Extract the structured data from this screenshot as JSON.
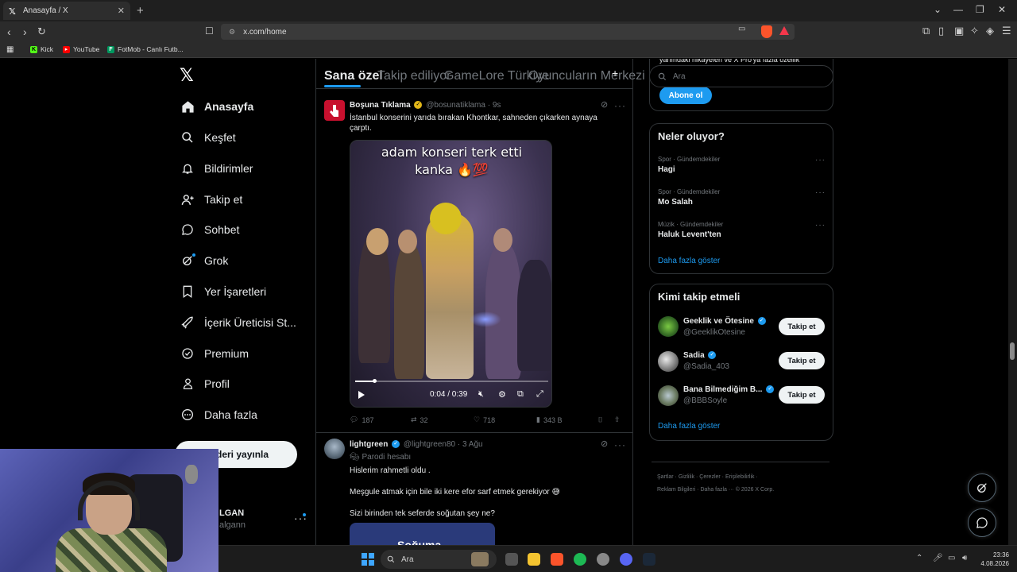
{
  "browser": {
    "tab_title": "Anasayfa / X",
    "url": "x.com/home",
    "bookmarks": [
      "Kick",
      "YouTube",
      "FotMob - Canlı Futb..."
    ]
  },
  "sidebar": {
    "items": [
      {
        "label": "Anasayfa",
        "icon": "home-icon"
      },
      {
        "label": "Keşfet",
        "icon": "search-icon"
      },
      {
        "label": "Bildirimler",
        "icon": "bell-icon"
      },
      {
        "label": "Takip et",
        "icon": "add-user-icon"
      },
      {
        "label": "Sohbet",
        "icon": "chat-icon"
      },
      {
        "label": "Grok",
        "icon": "grok-icon"
      },
      {
        "label": "Yer İşaretleri",
        "icon": "bookmark-icon"
      },
      {
        "label": "İçerik Üreticisi St...",
        "icon": "rocket-icon"
      },
      {
        "label": "Premium",
        "icon": "premium-icon"
      },
      {
        "label": "Profil",
        "icon": "person-icon"
      },
      {
        "label": "Daha fazla",
        "icon": "more-circle-icon"
      }
    ],
    "post_button": "deri yayınla",
    "user_name": "LGAN",
    "user_handle": "algann"
  },
  "feed": {
    "tabs": [
      "Sana özel",
      "Takip ediliyor",
      "GameLore Türkiye",
      "Oyuncuların Merkezi"
    ],
    "tweet1": {
      "name": "Boşuna Tıklama",
      "handle": "@bosunatiklama",
      "time": "9s",
      "text": "İstanbul konserini yarıda bırakan Khontkar, sahneden çıkarken aynaya çarptı.",
      "video_caption_line1": "adam konseri terk etti",
      "video_caption_line2": "kanka 🔥💯",
      "video_time": "0:04 / 0:39",
      "video_progress": 0.1,
      "replies": "187",
      "retweets": "32",
      "likes": "718",
      "views": "343 B"
    },
    "tweet2": {
      "name": "lightgreen",
      "handle": "@lightgreen80",
      "time": "3 Ağu",
      "parody_label": "Parodi hesabı",
      "line1": "Hislerim rahmetli oldu .",
      "line2": "Meşgule atmak için bile iki kere efor sarf etmek gerekiyor 😅",
      "line3": "Sizi birinden tek seferde soğutan şey ne?",
      "card_text": "Soğuma"
    }
  },
  "right": {
    "search_placeholder": "Ara",
    "cut_text": "yanındaki hikayeleri ve X Pro'ya fazla özellik",
    "subscribe_button": "Abone ol",
    "trends_title": "Neler oluyor?",
    "trends": [
      {
        "category": "Spor · Gündemdekiler",
        "name": "Hagi"
      },
      {
        "category": "Spor · Gündemdekiler",
        "name": "Mo Salah"
      },
      {
        "category": "Müzik · Gündemdekiler",
        "name": "Haluk Levent'ten"
      }
    ],
    "trends_show_more": "Daha fazla göster",
    "follow_title": "Kimi takip etmeli",
    "follow": [
      {
        "name": "Geeklik ve Ötesine",
        "handle": "@GeeklikOtesine",
        "button": "Takip et"
      },
      {
        "name": "Sadia",
        "handle": "@Sadia_403",
        "button": "Takip et"
      },
      {
        "name": "Bana Bilmediğim B...",
        "handle": "@BBBSoyle",
        "button": "Takip et"
      }
    ],
    "follow_show_more": "Daha fazla göster",
    "footer_line1": "Şartlar  ·  Gizlilik  ·  Çerezler  ·  Erişilebilirlik  ·",
    "footer_line2": "Reklam Bilgileri  ·  Daha fazla ···  © 2026 X Corp."
  },
  "taskbar": {
    "search_label": "Ara",
    "time": "23:36",
    "date": "4.08.2026"
  }
}
